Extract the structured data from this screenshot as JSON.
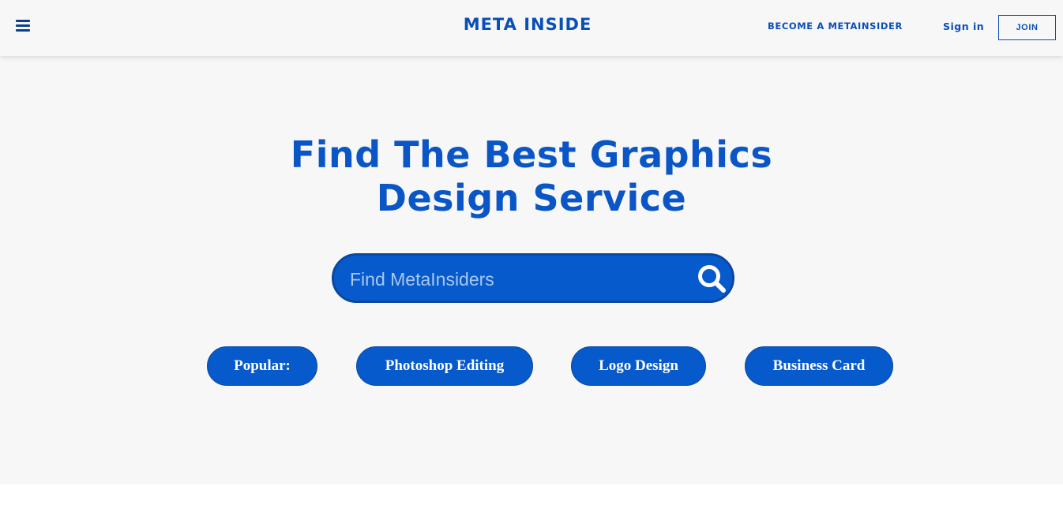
{
  "header": {
    "brand": "META INSIDE",
    "become_label": "BECOME A METAINSIDER",
    "signin_label": "Sign in",
    "join_label": "JOIN"
  },
  "hero": {
    "title_line1": "Find The Best Graphics",
    "title_line2": "Design Service",
    "search": {
      "placeholder": "Find MetaInsiders",
      "value": ""
    },
    "popular_label": "Popular:",
    "tags": [
      "Photoshop Editing",
      "Logo Design",
      "Business Card"
    ]
  },
  "icons": {
    "menu": "hamburger-menu-icon",
    "search": "search-icon"
  },
  "colors": {
    "brand_blue": "#0a56c6",
    "button_blue": "#075acb",
    "hero_bg": "#f7f7f8",
    "page_bg": "#ffffff"
  }
}
